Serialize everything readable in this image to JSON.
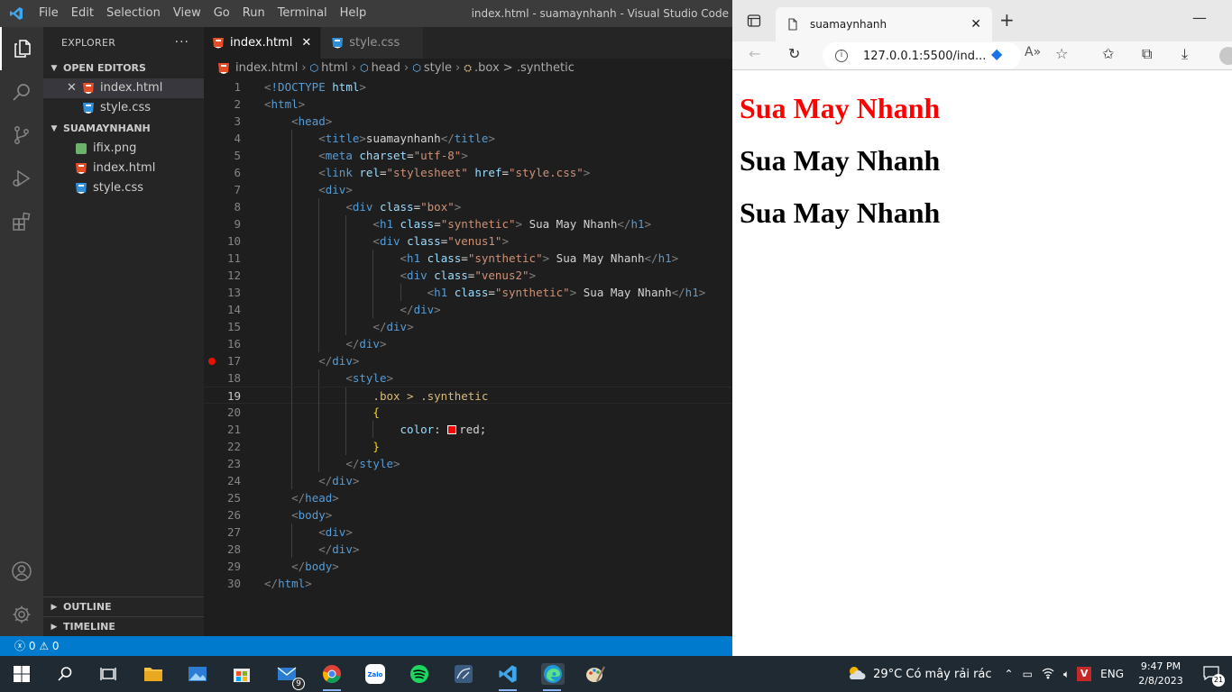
{
  "vscode": {
    "menu": [
      "File",
      "Edit",
      "Selection",
      "View",
      "Go",
      "Run",
      "Terminal",
      "Help"
    ],
    "window_title": "index.html - suamaynhanh - Visual Studio Code",
    "explorer_title": "EXPLORER",
    "open_editors_label": "OPEN EDITORS",
    "open_editors": [
      {
        "name": "index.html",
        "icon": "html-file-icon"
      },
      {
        "name": "style.css",
        "icon": "css-file-icon"
      }
    ],
    "folder_label": "SUAMAYNHANH",
    "files": [
      {
        "name": "ifix.png",
        "icon": "image-file-icon"
      },
      {
        "name": "index.html",
        "icon": "html-file-icon"
      },
      {
        "name": "style.css",
        "icon": "css-file-icon"
      }
    ],
    "outline_label": "OUTLINE",
    "timeline_label": "TIMELINE",
    "tabs": [
      {
        "name": "index.html",
        "active": true
      },
      {
        "name": "style.css",
        "active": false
      }
    ],
    "breadcrumb": [
      "index.html",
      "html",
      "head",
      "style",
      ".box > .synthetic"
    ],
    "current_line": 19,
    "breakpoint_line": 17,
    "status": {
      "errors": "0",
      "warnings": "0"
    }
  },
  "code_lines": [
    "<!DOCTYPE html>",
    "<html>",
    "    <head>",
    "        <title>suamaynhanh</title>",
    "        <meta charset=\"utf-8\">",
    "        <link rel=\"stylesheet\" href=\"style.css\">",
    "        <div>",
    "            <div class=\"box\">",
    "                <h1 class=\"synthetic\"> Sua May Nhanh</h1>",
    "                <div class=\"venus1\">",
    "                    <h1 class=\"synthetic\"> Sua May Nhanh</h1>",
    "                    <div class=\"venus2\">",
    "                        <h1 class=\"synthetic\"> Sua May Nhanh</h1>",
    "                    </div>",
    "                </div>",
    "            </div>",
    "        </div>",
    "            <style>",
    "                .box > .synthetic",
    "                {",
    "                    color: red;",
    "                }",
    "            </style>",
    "        </div>",
    "    </head>",
    "    <body>",
    "        <div>",
    "        </div>",
    "    </body>",
    "</html>"
  ],
  "browser": {
    "tab_title": "suamaynhanh",
    "url": "127.0.0.1:5500/ind...",
    "headings": [
      {
        "text": "Sua May Nhanh",
        "color": "#ff0000"
      },
      {
        "text": "Sua May Nhanh",
        "color": "#000000"
      },
      {
        "text": "Sua May Nhanh",
        "color": "#000000"
      }
    ]
  },
  "taskbar": {
    "mail_badge": "9",
    "weather": "29°C  Có mây rải rác",
    "language": "ENG",
    "time": "9:47 PM",
    "date": "2/8/2023",
    "notifications": "21"
  }
}
